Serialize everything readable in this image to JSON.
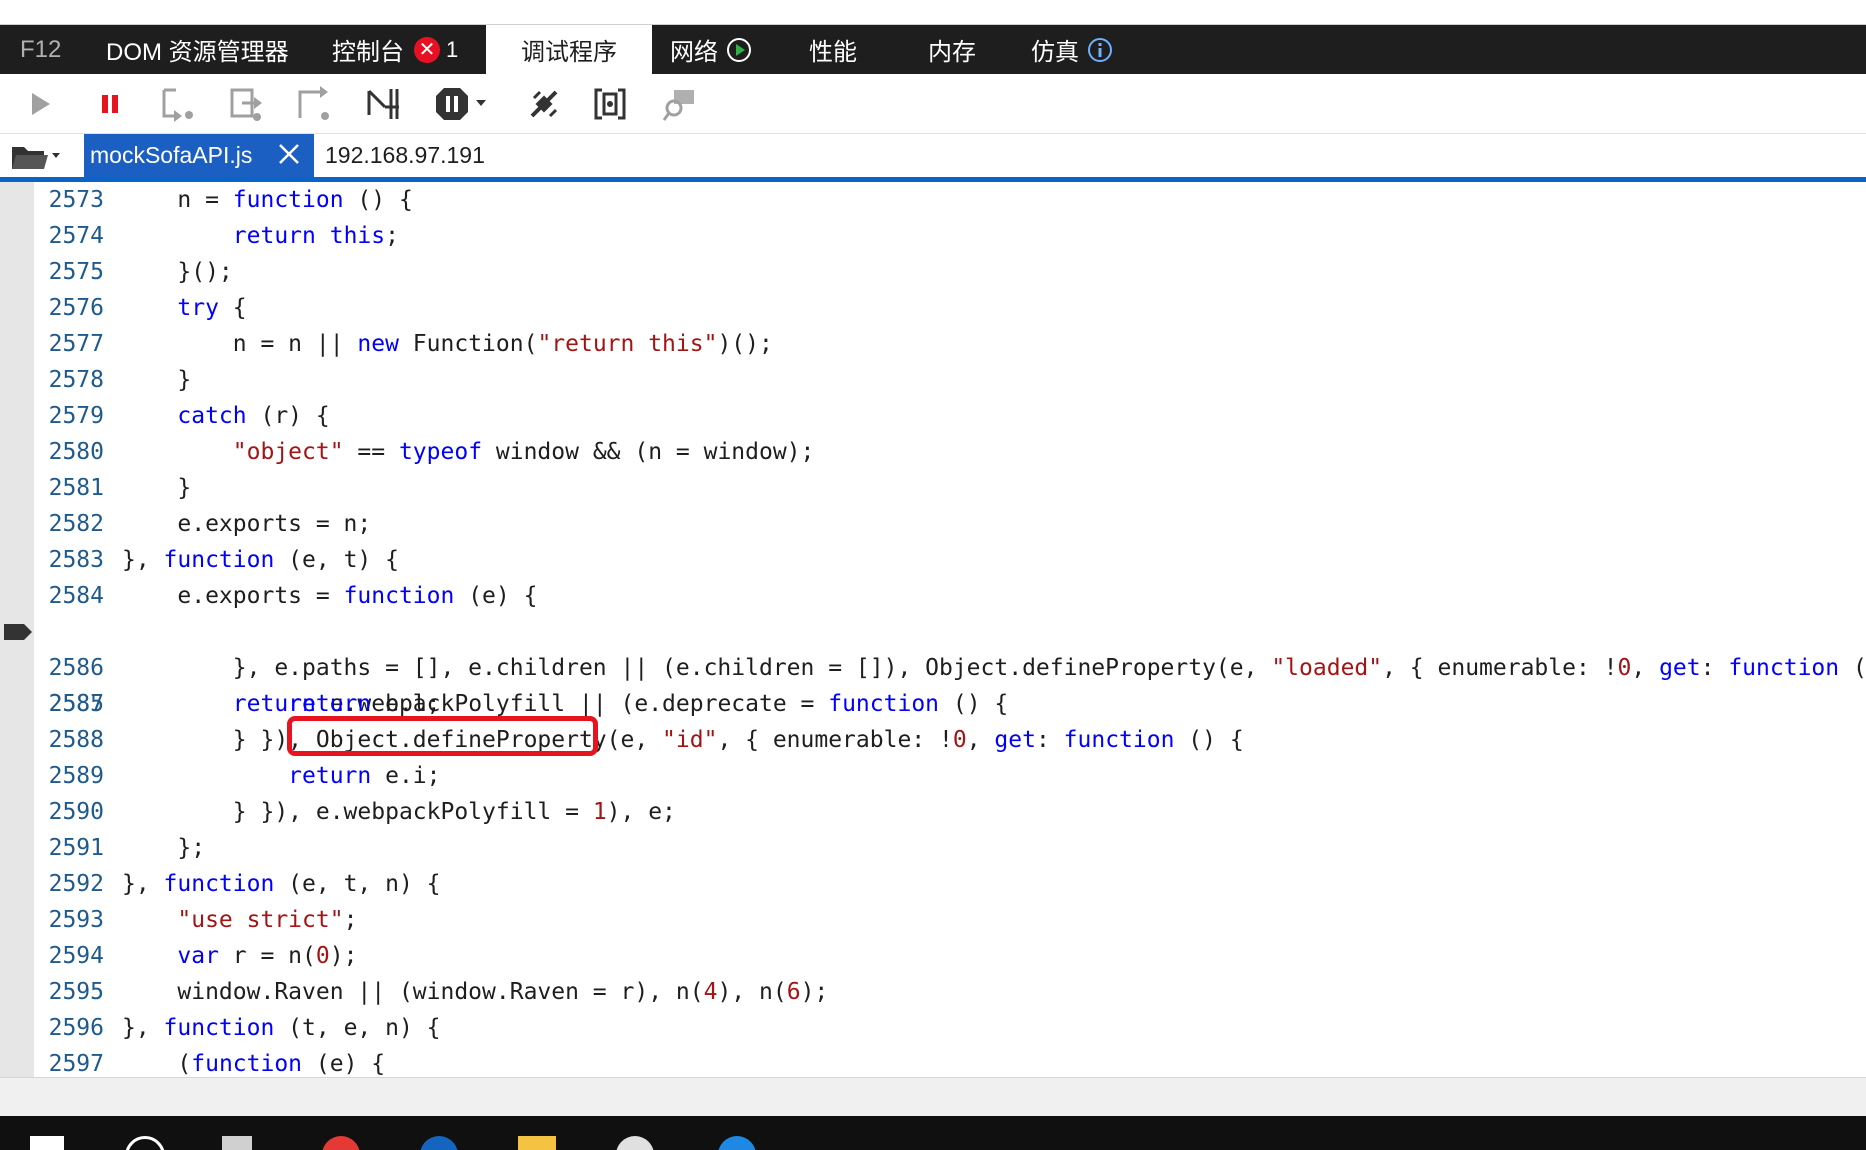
{
  "tabs": [
    {
      "label": "F12"
    },
    {
      "label": "DOM 资源管理器"
    },
    {
      "label": "控制台",
      "error_count": "1"
    },
    {
      "label": "调试程序"
    },
    {
      "label": "网络"
    },
    {
      "label": "性能"
    },
    {
      "label": "内存"
    },
    {
      "label": "仿真"
    }
  ],
  "toolbar": {
    "icons": [
      "continue-icon",
      "break-icon",
      "step-into-icon",
      "step-over-icon",
      "step-out-icon",
      "break-on-new-worker-icon",
      "exception-behavior-icon",
      "disconnect-icon",
      "pretty-print-icon",
      "find-references-icon"
    ]
  },
  "file": {
    "active_tab": "mockSofaAPI.js",
    "host": "192.168.97.191"
  },
  "editor": {
    "current_line": "2585",
    "highlighted_text": "Object.defineProperty(",
    "line_numbers": [
      "2573",
      "2574",
      "2575",
      "2576",
      "2577",
      "2578",
      "2579",
      "2580",
      "2581",
      "2582",
      "2583",
      "2584",
      "2585",
      "2586",
      "2587",
      "2588",
      "2589",
      "2590",
      "2591",
      "2592",
      "2593",
      "2594",
      "2595",
      "2596",
      "2597"
    ]
  },
  "colors": {
    "keyword": "#0000ff",
    "string": "#a31515",
    "line_number": "#1f5a8c",
    "tab_bar": "#1e1e1e",
    "file_tab": "#1c5fc2",
    "highlight_box": "#e5141e"
  }
}
